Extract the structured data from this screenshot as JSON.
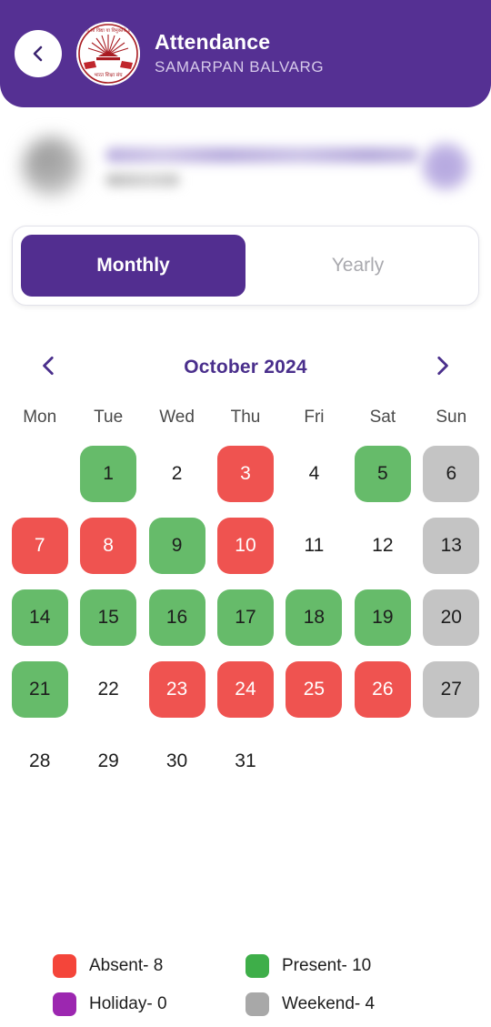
{
  "header": {
    "back_icon": "chevron-left-icon",
    "logo_icon": "school-crest-logo",
    "title": "Attendance",
    "subtitle": "SAMARPAN BALVARG",
    "background_color": "#553093"
  },
  "profile": {
    "redacted": true,
    "avatar_icon": "user-avatar",
    "badge_icon": "profile-badge"
  },
  "toggle": {
    "options": [
      {
        "label": "Monthly",
        "active": true
      },
      {
        "label": "Yearly",
        "active": false
      }
    ],
    "active_color": "#522e90"
  },
  "month_nav": {
    "prev_icon": "chevron-left-icon",
    "next_icon": "chevron-right-icon",
    "label": "October 2024"
  },
  "calendar": {
    "weekdays": [
      "Mon",
      "Tue",
      "Wed",
      "Thu",
      "Fri",
      "Sat",
      "Sun"
    ],
    "weeks": [
      [
        {
          "day": "",
          "status": "empty"
        },
        {
          "day": "1",
          "status": "present"
        },
        {
          "day": "2",
          "status": "none"
        },
        {
          "day": "3",
          "status": "absent"
        },
        {
          "day": "4",
          "status": "none"
        },
        {
          "day": "5",
          "status": "present"
        },
        {
          "day": "6",
          "status": "weekend"
        }
      ],
      [
        {
          "day": "7",
          "status": "absent"
        },
        {
          "day": "8",
          "status": "absent"
        },
        {
          "day": "9",
          "status": "present"
        },
        {
          "day": "10",
          "status": "absent"
        },
        {
          "day": "11",
          "status": "none"
        },
        {
          "day": "12",
          "status": "none"
        },
        {
          "day": "13",
          "status": "weekend"
        }
      ],
      [
        {
          "day": "14",
          "status": "present"
        },
        {
          "day": "15",
          "status": "present"
        },
        {
          "day": "16",
          "status": "present"
        },
        {
          "day": "17",
          "status": "present"
        },
        {
          "day": "18",
          "status": "present"
        },
        {
          "day": "19",
          "status": "present"
        },
        {
          "day": "20",
          "status": "weekend"
        }
      ],
      [
        {
          "day": "21",
          "status": "present"
        },
        {
          "day": "22",
          "status": "none"
        },
        {
          "day": "23",
          "status": "absent"
        },
        {
          "day": "24",
          "status": "absent"
        },
        {
          "day": "25",
          "status": "absent"
        },
        {
          "day": "26",
          "status": "absent"
        },
        {
          "day": "27",
          "status": "weekend"
        }
      ],
      [
        {
          "day": "28",
          "status": "none"
        },
        {
          "day": "29",
          "status": "none"
        },
        {
          "day": "30",
          "status": "none"
        },
        {
          "day": "31",
          "status": "none"
        },
        {
          "day": "",
          "status": "empty"
        },
        {
          "day": "",
          "status": "empty"
        },
        {
          "day": "",
          "status": "empty"
        }
      ]
    ],
    "status_colors": {
      "present": "#66bb6a",
      "absent": "#ef5350",
      "weekend": "#c4c4c4",
      "holiday": "#9c27b0"
    }
  },
  "legend": [
    {
      "label": "Absent- 8",
      "color": "#f4453a",
      "status": "absent"
    },
    {
      "label": "Present- 10",
      "color": "#3eae49",
      "status": "present"
    },
    {
      "label": "Holiday- 0",
      "color": "#9c27b0",
      "status": "holiday"
    },
    {
      "label": "Weekend- 4",
      "color": "#a8a8a8",
      "status": "weekend"
    }
  ]
}
